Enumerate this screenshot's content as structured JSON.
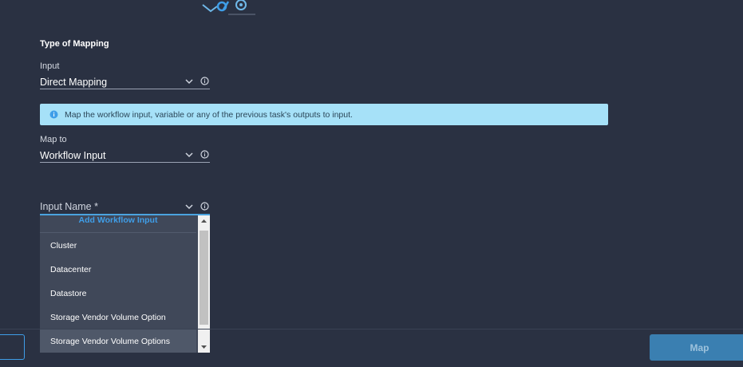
{
  "header": {
    "logo_icon": "workflow-gears-icon"
  },
  "mapping_type": {
    "section_title": "Type of Mapping",
    "input_label": "Input",
    "input_value": "Direct Mapping"
  },
  "banner": {
    "icon": "info-icon",
    "text": "Map the workflow input, variable or any of the previous task's outputs to input."
  },
  "map_to": {
    "label": "Map to",
    "value": "Workflow Input"
  },
  "input_name": {
    "label": "Input Name *",
    "dropdown": {
      "add_label": "Add Workflow Input",
      "options": [
        "Cluster",
        "Datacenter",
        "Datastore",
        "Storage Vendor Volume Option",
        "Storage Vendor Volume Options"
      ],
      "hovered_option": "Storage Vendor Volume Options"
    }
  },
  "footer": {
    "map_button_label": "Map"
  },
  "colors": {
    "background": "#2a3142",
    "accent": "#3f9ee8",
    "banner": "#a6e1f8",
    "map_button": "#3a7fb1"
  }
}
